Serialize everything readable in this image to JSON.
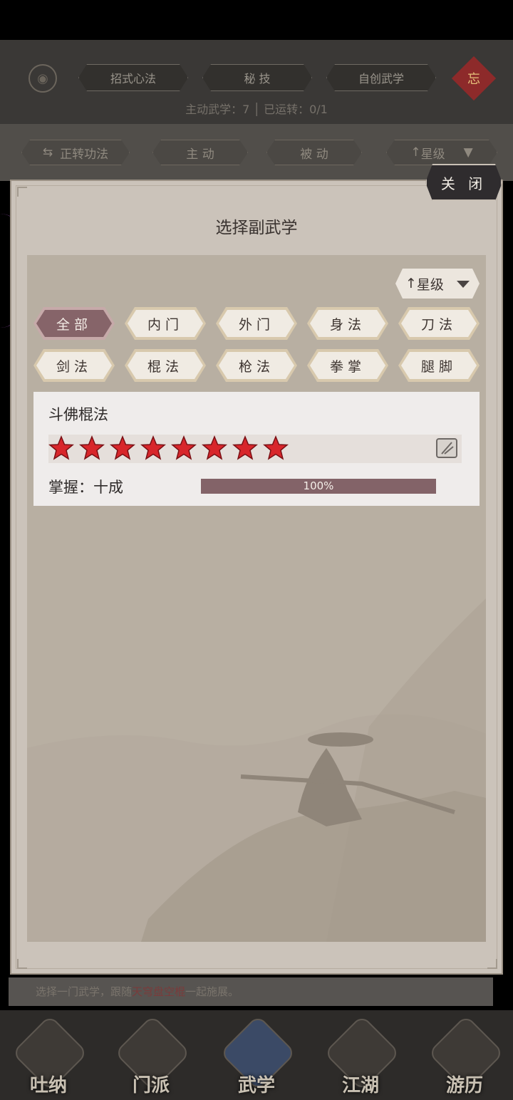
{
  "top_nav": {
    "tabs": [
      "招式心法",
      "秘 技",
      "自创武学"
    ],
    "counts_text": "主动武学：7 │ 已运转：0/1",
    "knot_char": "忘"
  },
  "sub_bar": {
    "tabs": [
      "正转功法",
      "主 动",
      "被 动",
      "星级"
    ]
  },
  "dialog": {
    "title": "选择副武学",
    "close_label": "关 闭",
    "sort_label": "星级",
    "filters_row1": [
      "全部",
      "内门",
      "外门",
      "身法",
      "刀法"
    ],
    "filters_row2": [
      "剑法",
      "棍法",
      "枪法",
      "拳掌",
      "腿脚"
    ],
    "active_filter": "全部",
    "skill": {
      "name": "斗佛棍法",
      "stars": 8,
      "mastery_label": "掌握：十成",
      "progress_text": "100%",
      "progress": 1.0
    }
  },
  "bottom_hint": {
    "prefix": "选择一门武学，跟随",
    "highlight": "天穹盘空棍",
    "suffix": "一起施展。"
  },
  "bottom_nav": [
    "吐纳",
    "门派",
    "武学",
    "江湖",
    "游历"
  ],
  "colors": {
    "accent": "#866469",
    "star": "#d8262b",
    "panel": "#b8afa2"
  }
}
